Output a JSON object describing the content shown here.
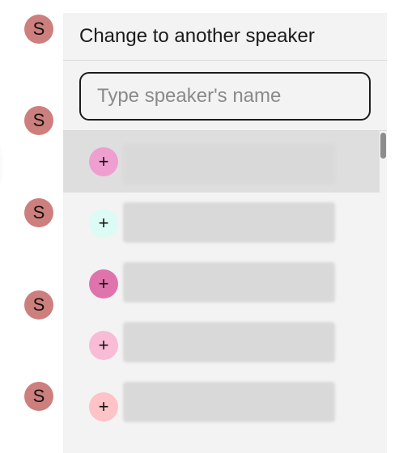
{
  "speakers": [
    {
      "initial": "S",
      "color": "#cc7f7d"
    },
    {
      "initial": "S",
      "color": "#cc7f7d"
    },
    {
      "initial": "S",
      "color": "#cc7f7d"
    },
    {
      "initial": "S",
      "color": "#cc7f7d"
    },
    {
      "initial": "S",
      "color": "#cc7f7d"
    }
  ],
  "dropdown": {
    "title": "Change to another speaker",
    "search_placeholder": "Type speaker's name",
    "search_value": "",
    "items": [
      {
        "add_label": "+",
        "color": "#ee9fd0",
        "selected": true,
        "icon": "plus-icon"
      },
      {
        "add_label": "+",
        "color": "#dcfbf4",
        "selected": false,
        "icon": "plus-icon"
      },
      {
        "add_label": "+",
        "color": "#df74ac",
        "selected": false,
        "icon": "plus-icon"
      },
      {
        "add_label": "+",
        "color": "#f8bcd6",
        "selected": false,
        "icon": "plus-icon"
      },
      {
        "add_label": "+",
        "color": "#fdc3c6",
        "selected": false,
        "icon": "plus-icon"
      }
    ]
  }
}
